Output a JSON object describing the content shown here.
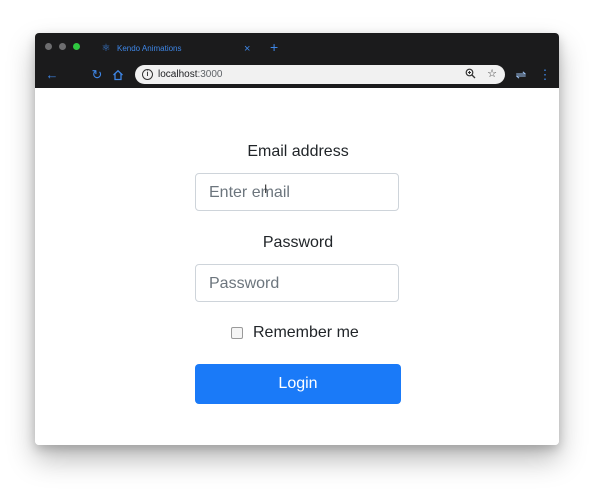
{
  "browser": {
    "tab": {
      "icon": "react-atom-icon",
      "title": "Kendo Animations"
    },
    "url": {
      "host": "localhost",
      "port": ":3000"
    },
    "colors": {
      "chrome": "#1b1b1c",
      "accent": "#3e86e6",
      "omnibox": "#f1f1f1"
    }
  },
  "form": {
    "email_label": "Email address",
    "email_placeholder": "Enter email",
    "password_label": "Password",
    "password_placeholder": "Password",
    "remember_label": "Remember me",
    "remember_checked": false,
    "login_label": "Login",
    "colors": {
      "primary": "#1a7af8",
      "border": "#ced4da"
    }
  }
}
